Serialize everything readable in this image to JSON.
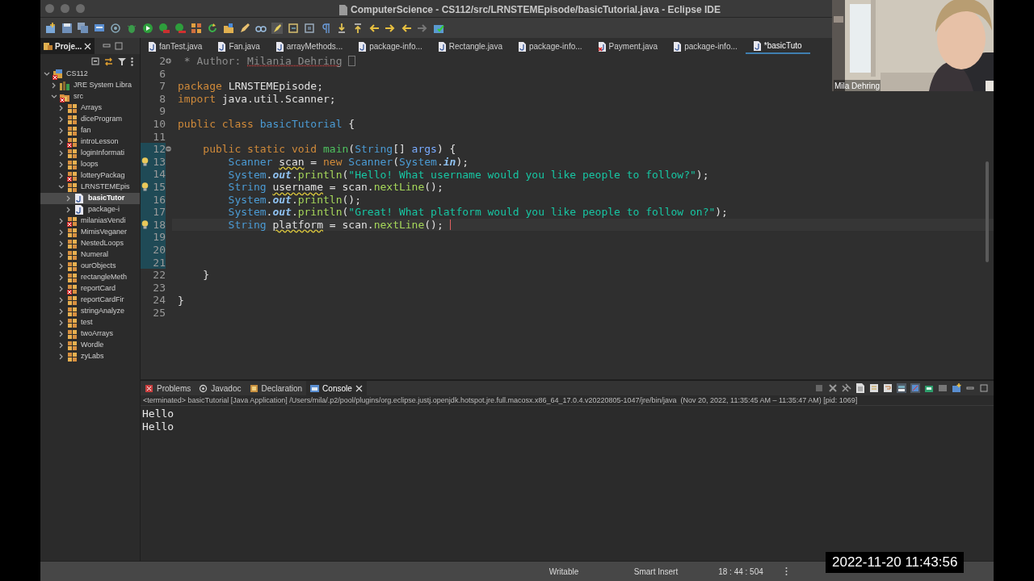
{
  "window": {
    "title": "ComputerScience - CS112/src/LRNSTEMEpisode/basicTutorial.java - Eclipse IDE"
  },
  "sidebar": {
    "tab": {
      "label": "Proje...",
      "selected": true
    },
    "tree": [
      {
        "label": "CS112",
        "kind": "project",
        "expanded": true,
        "error": true,
        "selected": false,
        "children": [
          {
            "label": "JRE System Libra",
            "kind": "library",
            "expanded": false,
            "error": false,
            "selected": false
          },
          {
            "label": "src",
            "kind": "folder",
            "expanded": true,
            "error": true,
            "selected": false,
            "children": [
              {
                "label": "Arrays",
                "kind": "package",
                "expanded": false,
                "error": false,
                "selected": false
              },
              {
                "label": "diceProgram",
                "kind": "package",
                "expanded": false,
                "error": false,
                "selected": false
              },
              {
                "label": "fan",
                "kind": "package",
                "expanded": false,
                "error": false,
                "selected": false
              },
              {
                "label": "introLesson",
                "kind": "package",
                "expanded": false,
                "error": true,
                "selected": false
              },
              {
                "label": "loginInformati",
                "kind": "package",
                "expanded": false,
                "error": false,
                "selected": false
              },
              {
                "label": "loops",
                "kind": "package",
                "expanded": false,
                "error": false,
                "selected": false
              },
              {
                "label": "lotteryPackag",
                "kind": "package",
                "expanded": false,
                "error": true,
                "selected": false
              },
              {
                "label": "LRNSTEMEpis",
                "kind": "package",
                "expanded": true,
                "error": false,
                "selected": false,
                "children": [
                  {
                    "label": "basicTutor",
                    "kind": "file",
                    "expanded": false,
                    "error": false,
                    "selected": true
                  },
                  {
                    "label": "package-i",
                    "kind": "file",
                    "expanded": false,
                    "error": false,
                    "selected": false
                  }
                ]
              },
              {
                "label": "milaniasVendi",
                "kind": "package",
                "expanded": false,
                "error": true,
                "selected": false
              },
              {
                "label": "MimisVeganer",
                "kind": "package",
                "expanded": false,
                "error": false,
                "selected": false
              },
              {
                "label": "NestedLoops",
                "kind": "package",
                "expanded": false,
                "error": false,
                "selected": false
              },
              {
                "label": "Numeral",
                "kind": "package",
                "expanded": false,
                "error": false,
                "selected": false
              },
              {
                "label": "ourObjects",
                "kind": "package",
                "expanded": false,
                "error": false,
                "selected": false
              },
              {
                "label": "rectangleMeth",
                "kind": "package",
                "expanded": false,
                "error": false,
                "selected": false
              },
              {
                "label": "reportCard",
                "kind": "package",
                "expanded": false,
                "error": true,
                "selected": false
              },
              {
                "label": "reportCardFir",
                "kind": "package",
                "expanded": false,
                "error": false,
                "selected": false
              },
              {
                "label": "stringAnalyze",
                "kind": "package",
                "expanded": false,
                "error": false,
                "selected": false
              },
              {
                "label": "test",
                "kind": "package",
                "expanded": false,
                "error": false,
                "selected": false
              },
              {
                "label": "twoArrays",
                "kind": "package",
                "expanded": false,
                "error": false,
                "selected": false
              },
              {
                "label": "Wordle",
                "kind": "package",
                "expanded": false,
                "error": false,
                "selected": false
              },
              {
                "label": "zyLabs",
                "kind": "package",
                "expanded": false,
                "error": false,
                "selected": false
              }
            ]
          }
        ]
      }
    ]
  },
  "editor_tabs": [
    {
      "label": "fanTest.java",
      "selected": false,
      "error": false
    },
    {
      "label": "Fan.java",
      "selected": false,
      "error": false
    },
    {
      "label": "arrayMethods...",
      "selected": false,
      "error": false
    },
    {
      "label": "package-info...",
      "selected": false,
      "error": false
    },
    {
      "label": "Rectangle.java",
      "selected": false,
      "error": false
    },
    {
      "label": "package-info...",
      "selected": false,
      "error": false
    },
    {
      "label": "Payment.java",
      "selected": false,
      "error": true
    },
    {
      "label": "package-info...",
      "selected": false,
      "error": false
    },
    {
      "label": "*basicTuto",
      "selected": true,
      "error": false
    }
  ],
  "editor": {
    "lines": [
      {
        "number": "2",
        "foldable": true,
        "folded": true,
        "warning": false,
        "changed": false,
        "current": false,
        "tokens": [
          {
            "kind": "comment",
            "text": " * Author: "
          },
          {
            "kind": "spell",
            "text": "Milania Dehring"
          }
        ]
      },
      {
        "number": "6",
        "warning": false,
        "changed": false,
        "current": false
      },
      {
        "number": "7",
        "warning": false,
        "changed": false,
        "current": false,
        "tokens": [
          {
            "kind": "kw",
            "text": "package "
          },
          {
            "kind": "plain",
            "text": "LRNSTEMEpisode;"
          }
        ]
      },
      {
        "number": "8",
        "warning": false,
        "changed": false,
        "current": false,
        "tokens": [
          {
            "kind": "kw",
            "text": "import "
          },
          {
            "kind": "plain",
            "text": "java.util.Scanner;"
          }
        ]
      },
      {
        "number": "9",
        "warning": false,
        "changed": false,
        "current": false
      },
      {
        "number": "10",
        "warning": false,
        "changed": false,
        "current": false,
        "tokens": [
          {
            "kind": "kw",
            "text": "public class "
          },
          {
            "kind": "type",
            "text": "basicTutorial"
          },
          {
            "kind": "plain",
            "text": " {"
          }
        ]
      },
      {
        "number": "11",
        "warning": false,
        "changed": false,
        "current": false
      },
      {
        "number": "12",
        "foldable": true,
        "folded": false,
        "warning": false,
        "changed": true,
        "current": false,
        "tokens": [
          {
            "kind": "kw",
            "text": "    public static void "
          },
          {
            "kind": "decl",
            "text": "main"
          },
          {
            "kind": "plain",
            "text": "("
          },
          {
            "kind": "type",
            "text": "String"
          },
          {
            "kind": "plain",
            "text": "[] "
          },
          {
            "kind": "param",
            "text": "args"
          },
          {
            "kind": "plain",
            "text": ") {"
          }
        ]
      },
      {
        "number": "13",
        "warning": true,
        "changed": true,
        "current": false,
        "tokens": [
          {
            "kind": "type",
            "text": "        Scanner "
          },
          {
            "kind": "var",
            "text": "scan"
          },
          {
            "kind": "plain",
            "text": " = "
          },
          {
            "kind": "kw",
            "text": "new "
          },
          {
            "kind": "type",
            "text": "Scanner"
          },
          {
            "kind": "plain",
            "text": "("
          },
          {
            "kind": "type",
            "text": "System"
          },
          {
            "kind": "plain",
            "text": "."
          },
          {
            "kind": "field",
            "text": "in"
          },
          {
            "kind": "plain",
            "text": ");"
          }
        ]
      },
      {
        "number": "14",
        "warning": false,
        "changed": true,
        "current": false,
        "tokens": [
          {
            "kind": "type",
            "text": "        System"
          },
          {
            "kind": "plain",
            "text": "."
          },
          {
            "kind": "field",
            "text": "out"
          },
          {
            "kind": "plain",
            "text": "."
          },
          {
            "kind": "method",
            "text": "println"
          },
          {
            "kind": "plain",
            "text": "("
          },
          {
            "kind": "str",
            "text": "\"Hello! What username would you like people to follow?\""
          },
          {
            "kind": "plain",
            "text": ");"
          }
        ]
      },
      {
        "number": "15",
        "warning": true,
        "changed": true,
        "current": false,
        "tokens": [
          {
            "kind": "type",
            "text": "        String "
          },
          {
            "kind": "var",
            "text": "username"
          },
          {
            "kind": "plain",
            "text": " = scan."
          },
          {
            "kind": "method",
            "text": "nextLine"
          },
          {
            "kind": "plain",
            "text": "();"
          }
        ]
      },
      {
        "number": "16",
        "warning": false,
        "changed": true,
        "current": false,
        "tokens": [
          {
            "kind": "type",
            "text": "        System"
          },
          {
            "kind": "plain",
            "text": "."
          },
          {
            "kind": "field",
            "text": "out"
          },
          {
            "kind": "plain",
            "text": "."
          },
          {
            "kind": "method",
            "text": "println"
          },
          {
            "kind": "plain",
            "text": "();"
          }
        ]
      },
      {
        "number": "17",
        "warning": false,
        "changed": true,
        "current": false,
        "tokens": [
          {
            "kind": "type",
            "text": "        System"
          },
          {
            "kind": "plain",
            "text": "."
          },
          {
            "kind": "field",
            "text": "out"
          },
          {
            "kind": "plain",
            "text": "."
          },
          {
            "kind": "method",
            "text": "println"
          },
          {
            "kind": "plain",
            "text": "("
          },
          {
            "kind": "str",
            "text": "\"Great! What platform would you like people to follow on?\""
          },
          {
            "kind": "plain",
            "text": ");"
          }
        ]
      },
      {
        "number": "18",
        "warning": true,
        "changed": true,
        "current": true,
        "tokens": [
          {
            "kind": "type",
            "text": "        String "
          },
          {
            "kind": "var",
            "text": "platform"
          },
          {
            "kind": "plain",
            "text": " = scan."
          },
          {
            "kind": "method",
            "text": "nextLine"
          },
          {
            "kind": "plain",
            "text": "();"
          }
        ]
      },
      {
        "number": "19",
        "warning": false,
        "changed": true,
        "current": false
      },
      {
        "number": "20",
        "warning": false,
        "changed": true,
        "current": false
      },
      {
        "number": "21",
        "warning": false,
        "changed": true,
        "current": false
      },
      {
        "number": "22",
        "warning": false,
        "changed": false,
        "current": false,
        "tokens": [
          {
            "kind": "plain",
            "text": "    }"
          }
        ]
      },
      {
        "number": "23",
        "warning": false,
        "changed": false,
        "current": false
      },
      {
        "number": "24",
        "warning": false,
        "changed": false,
        "current": false,
        "tokens": [
          {
            "kind": "plain",
            "text": "}"
          }
        ]
      },
      {
        "number": "25",
        "warning": false,
        "changed": false,
        "current": false
      }
    ]
  },
  "bottom_panel": {
    "tabs": [
      {
        "label": "Problems",
        "selected": false
      },
      {
        "label": "Javadoc",
        "selected": false
      },
      {
        "label": "Declaration",
        "selected": false
      },
      {
        "label": "Console",
        "selected": true
      }
    ],
    "console_header": "<terminated> basicTutorial [Java Application] /Users/mila/.p2/pool/plugins/org.eclipse.justj.openjdk.hotspot.jre.full.macosx.x86_64_17.0.4.v20220805-1047/jre/bin/java  (Nov 20, 2022, 11:35:45 AM – 11:35:47 AM) [pid: 1069]",
    "console_lines": [
      "Hello",
      "Hello"
    ]
  },
  "status_bar": {
    "mode": "Writable",
    "insert": "Smart Insert",
    "position": "18 : 44 : 504"
  },
  "webcam": {
    "kind": "picture",
    "name": "Mila Dehring"
  },
  "timestamp": "2022-11-20 11:43:56"
}
